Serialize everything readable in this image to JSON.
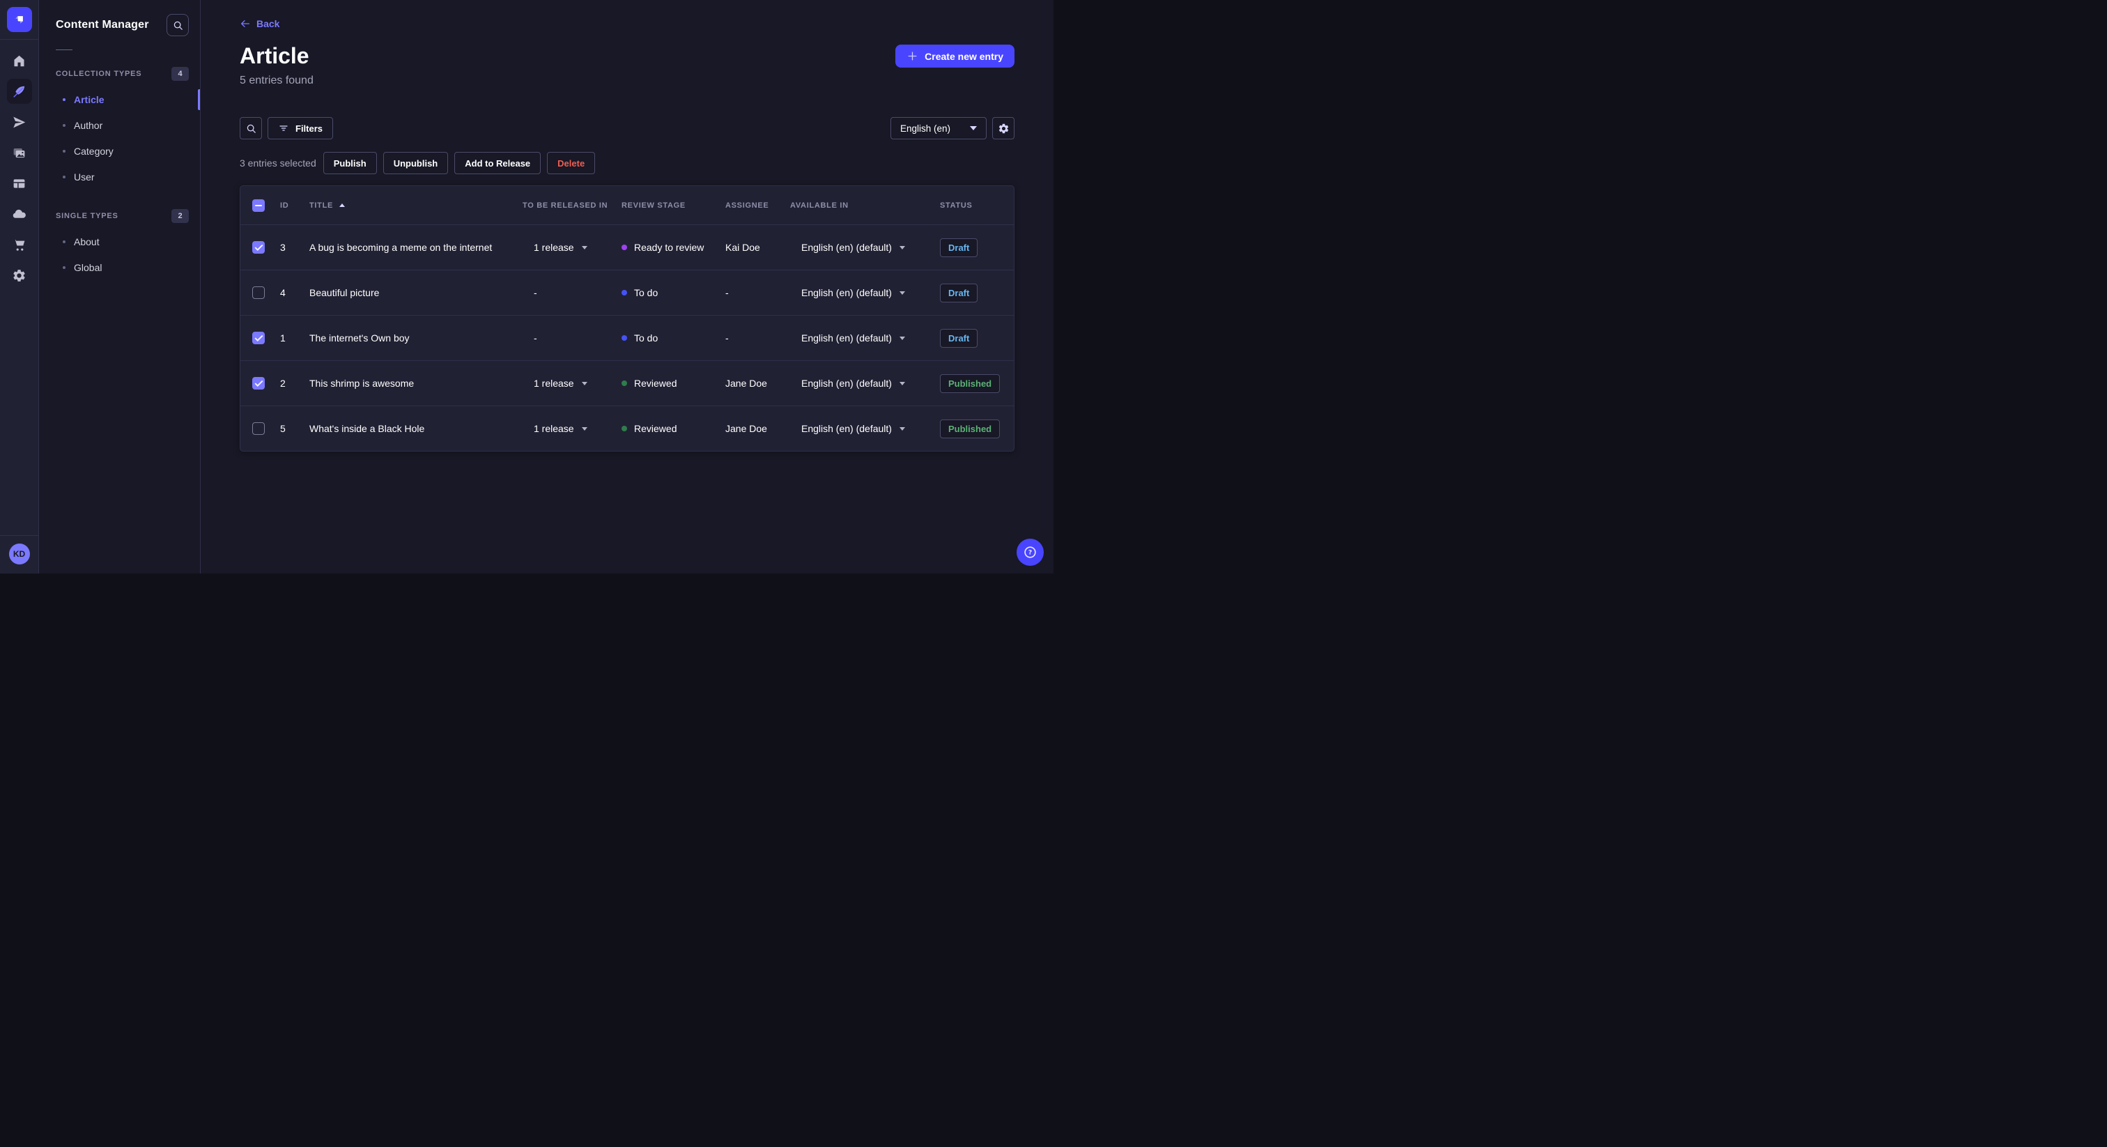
{
  "nav": {
    "logo": "strapi-logo",
    "icons": [
      "home",
      "content-manager-feather",
      "releases-send",
      "media-library-images",
      "content-type-builder-layout",
      "cloud",
      "marketplace-cart",
      "settings-gear"
    ],
    "active_icon": "content-manager-feather",
    "avatar_initials": "KD"
  },
  "subnav": {
    "title": "Content Manager",
    "sections": [
      {
        "label": "COLLECTION TYPES",
        "count": "4",
        "items": [
          {
            "label": "Article",
            "active": true
          },
          {
            "label": "Author",
            "active": false
          },
          {
            "label": "Category",
            "active": false
          },
          {
            "label": "User",
            "active": false
          }
        ]
      },
      {
        "label": "SINGLE TYPES",
        "count": "2",
        "items": [
          {
            "label": "About",
            "active": false
          },
          {
            "label": "Global",
            "active": false
          }
        ]
      }
    ]
  },
  "header": {
    "back_label": "Back",
    "title": "Article",
    "subtitle": "5 entries found",
    "create_button_label": "Create new entry"
  },
  "toolbar": {
    "filters_label": "Filters",
    "locale_value": "English (en)"
  },
  "selection": {
    "text": "3 entries selected",
    "publish_label": "Publish",
    "unpublish_label": "Unpublish",
    "add_to_release_label": "Add to Release",
    "delete_label": "Delete"
  },
  "table": {
    "headers": {
      "id": "ID",
      "title": "TITLE",
      "release": "TO BE RELEASED IN",
      "review": "REVIEW STAGE",
      "assignee": "ASSIGNEE",
      "available": "AVAILABLE IN",
      "status": "STATUS"
    },
    "rows": [
      {
        "checked": true,
        "id": "3",
        "title": "A bug is becoming a meme on the internet",
        "release": "1 release",
        "review": "Ready to review",
        "review_color": "#9d43ee",
        "assignee": "Kai Doe",
        "available": "English (en) (default)",
        "status": "Draft"
      },
      {
        "checked": false,
        "id": "4",
        "title": "Beautiful picture",
        "release": "-",
        "review": "To do",
        "review_color": "#4652f6",
        "assignee": "-",
        "available": "English (en) (default)",
        "status": "Draft"
      },
      {
        "checked": true,
        "id": "1",
        "title": "The internet's Own boy",
        "release": "-",
        "review": "To do",
        "review_color": "#4652f6",
        "assignee": "-",
        "available": "English (en) (default)",
        "status": "Draft"
      },
      {
        "checked": true,
        "id": "2",
        "title": "This shrimp is awesome",
        "release": "1 release",
        "review": "Reviewed",
        "review_color": "#2f7d4c",
        "assignee": "Jane Doe",
        "available": "English (en) (default)",
        "status": "Published"
      },
      {
        "checked": false,
        "id": "5",
        "title": "What's inside a Black Hole",
        "release": "1 release",
        "review": "Reviewed",
        "review_color": "#2f7d4c",
        "assignee": "Jane Doe",
        "available": "English (en) (default)",
        "status": "Published"
      }
    ]
  },
  "colors": {
    "accent": "#4945ff",
    "link": "#7b79ff",
    "draft": "#66b7f1",
    "published": "#5cb176",
    "danger": "#ee5e52"
  }
}
